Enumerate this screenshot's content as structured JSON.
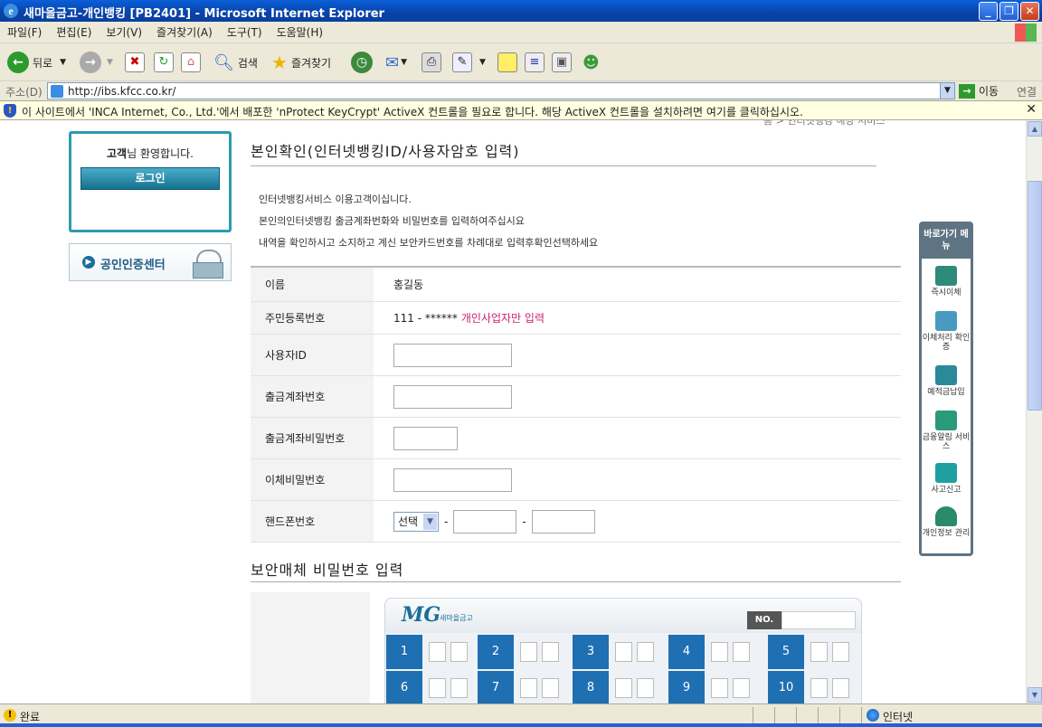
{
  "window": {
    "title": "새마을금고-개인뱅킹 [PB2401] - Microsoft Internet Explorer"
  },
  "menu": [
    "파일(F)",
    "편집(E)",
    "보기(V)",
    "즐겨찾기(A)",
    "도구(T)",
    "도움말(H)"
  ],
  "toolbar": {
    "back": "뒤로",
    "search": "검색",
    "favorites": "즐겨찾기"
  },
  "address": {
    "label": "주소(D)",
    "url": "http://ibs.kfcc.co.kr/",
    "go": "이동",
    "links": "연결"
  },
  "infobar": {
    "text": "이 사이트에서 'INCA Internet, Co., Ltd.'에서 배포한 'nProtect KeyCrypt' ActiveX 컨트롤을 필요로 합니다. 해당 ActiveX 컨트롤을 설치하려면 여기를 클릭하십시오."
  },
  "left": {
    "welcome_bold": "고객",
    "welcome_rest": "님 환영합니다.",
    "login": "로그인",
    "cert": "공인인증센터"
  },
  "breadcrumb": "홈 > 인터넷뱅킹 해당 서비스",
  "main": {
    "title": "본인확인(인터넷뱅킹ID/사용자암호 입력)",
    "intro": [
      "인터넷뱅킹서비스 이용고객이십니다.",
      "본인의인터넷뱅킹 출금계좌번화와 비밀번호를 입력하여주십시요",
      "내역을 확인하시고 소지하고 계신 보안카드번호를 차례대로 입력후확인선택하세요"
    ],
    "rows": {
      "name_label": "이름",
      "name_value": "홍길동",
      "rrn_label": "주민등록번호",
      "rrn_value": "111 - ******",
      "rrn_note": "개인사업자만 입력",
      "userid_label": "사용자ID",
      "account_label": "출금계좌번호",
      "account_pw_label": "출금계좌비밀번호",
      "transfer_pw_label": "이체비밀번호",
      "phone_label": "핸드폰번호",
      "phone_select": "선택",
      "dash": "-"
    },
    "security_title": "보안매체 비밀번호 입력",
    "card": {
      "brand": "MG",
      "brand_sub": "새마을금고",
      "no_label": "NO.",
      "numbers": [
        "1",
        "2",
        "3",
        "4",
        "5",
        "6",
        "7",
        "8",
        "9",
        "10"
      ]
    }
  },
  "quickmenu": {
    "title": "바로가기 메뉴",
    "items": [
      "즉시이체",
      "이체처리 확인증",
      "예적금납입",
      "금융알림 서비스",
      "사고신고",
      "개인정보 관리"
    ]
  },
  "status": {
    "text": "완료",
    "zone": "인터넷"
  },
  "colors": {
    "titlebar": "#0a5fd8",
    "accent": "#2a9cb0",
    "card_cell": "#1f6fb3",
    "pink": "#c8246e"
  }
}
